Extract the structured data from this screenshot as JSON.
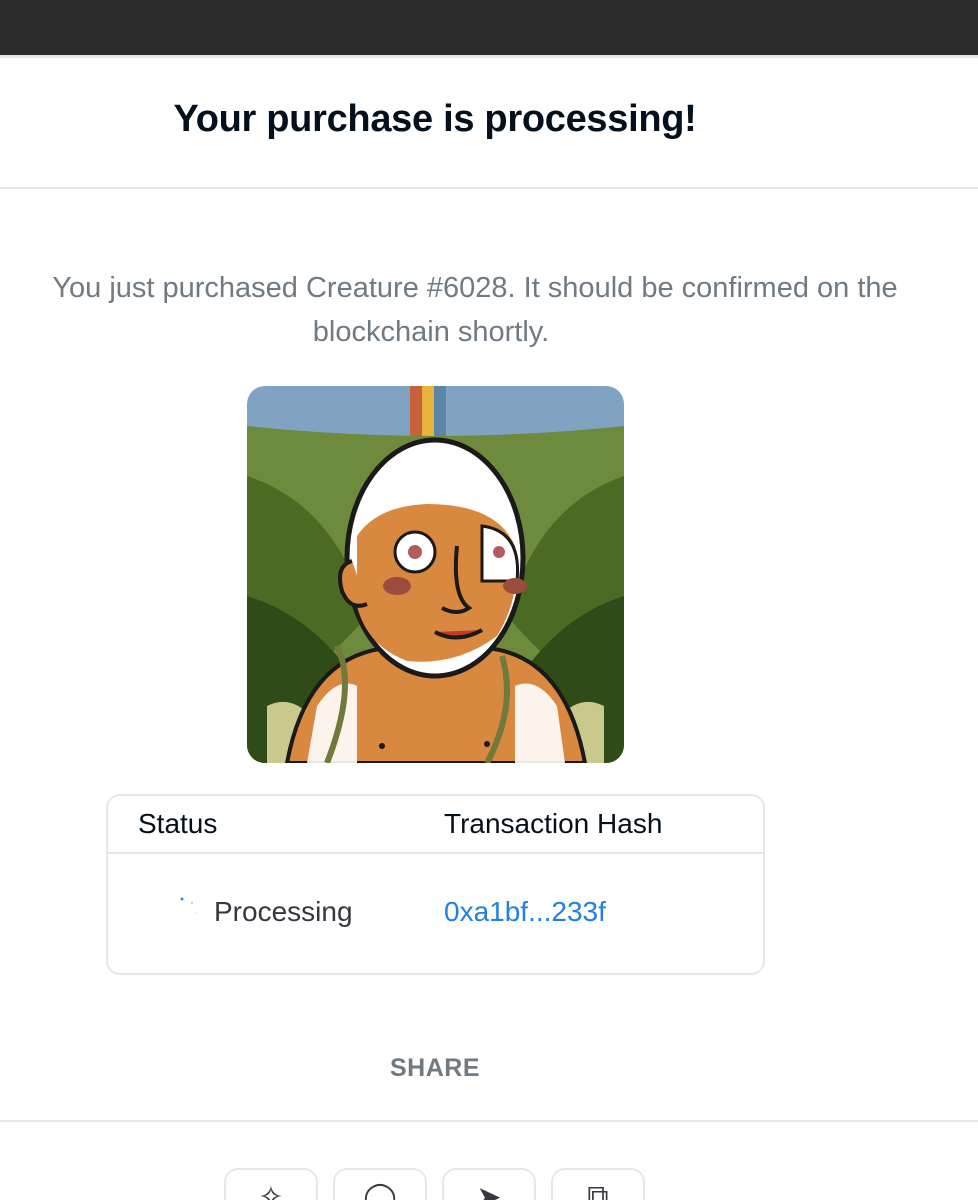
{
  "modal": {
    "title": "Your purchase is processing!",
    "message_line1": "You just purchased Creature #6028. It should be confirmed on the",
    "message_line2": "blockchain shortly.",
    "nft_image_alt": "Creature #6028"
  },
  "transaction": {
    "headers": {
      "status": "Status",
      "hash": "Transaction Hash"
    },
    "status": "Processing",
    "hash": "0xa1bf...233f"
  },
  "share": {
    "label": "SHARE",
    "buttons": [
      {
        "icon": "twitter-icon"
      },
      {
        "icon": "facebook-icon"
      },
      {
        "icon": "telegram-icon"
      },
      {
        "icon": "copy-link-icon"
      }
    ]
  },
  "colors": {
    "text_primary": "#04111d",
    "text_secondary": "#707a83",
    "link": "#2081e2",
    "border": "#e5e8eb"
  }
}
